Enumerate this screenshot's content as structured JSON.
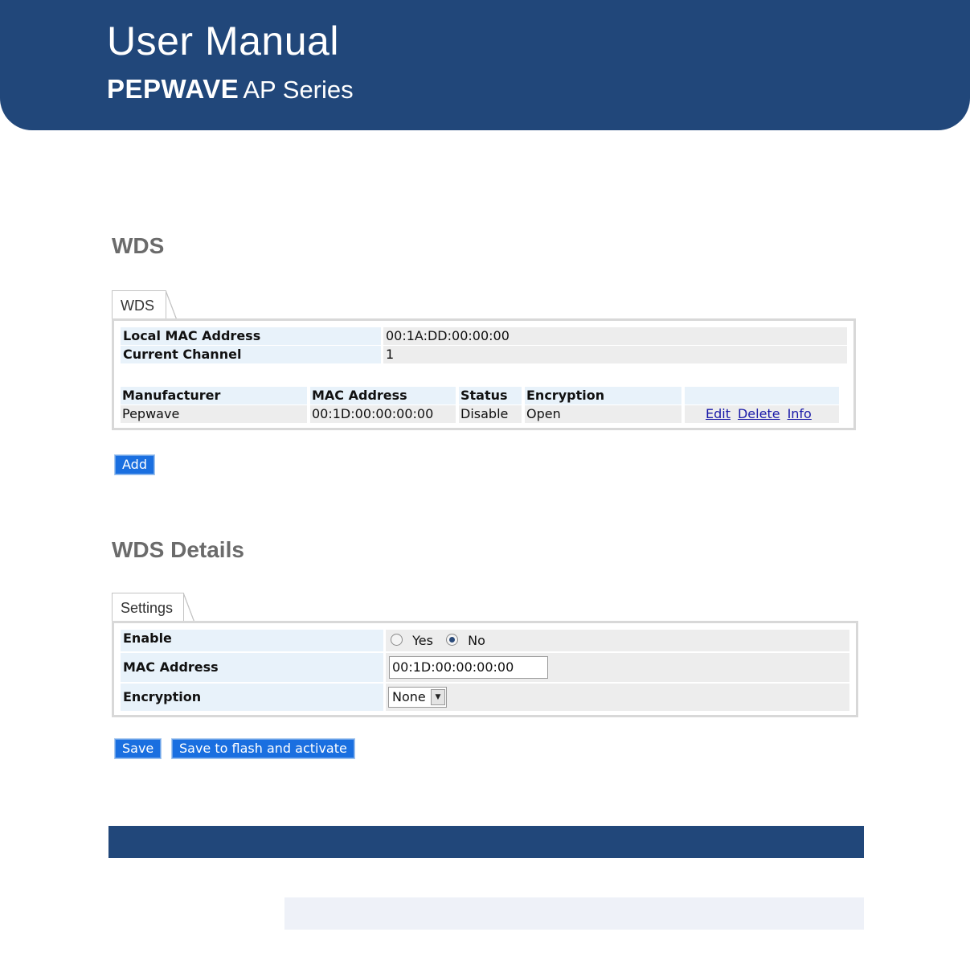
{
  "header": {
    "title": "User Manual",
    "brand": "PEPWAVE",
    "series": "AP Series"
  },
  "wds": {
    "section_title": "WDS",
    "tab_label": "WDS",
    "local_mac_label": "Local MAC Address",
    "local_mac_value": "00:1A:DD:00:00:00",
    "channel_label": "Current Channel",
    "channel_value": "1",
    "table": {
      "headers": [
        "Manufacturer",
        "MAC Address",
        "Status",
        "Encryption"
      ],
      "rows": [
        {
          "manufacturer": "Pepwave",
          "mac": "00:1D:00:00:00:00",
          "status": "Disable",
          "encryption": "Open",
          "actions": [
            "Edit",
            "Delete",
            "Info"
          ]
        }
      ]
    },
    "add_button": "Add"
  },
  "details": {
    "section_title": "WDS Details",
    "tab_label": "Settings",
    "enable_label": "Enable",
    "enable_options": [
      "Yes",
      "No"
    ],
    "enable_selected": "No",
    "mac_label": "MAC Address",
    "mac_value": "00:1D:00:00:00:00",
    "encryption_label": "Encryption",
    "encryption_value": "None",
    "save_button": "Save",
    "save_activate_button": "Save to flash and activate"
  },
  "colors": {
    "banner": "#21477a",
    "button": "#1a6fe0",
    "label_bg": "#e8f2fa",
    "value_bg": "#ededed"
  }
}
